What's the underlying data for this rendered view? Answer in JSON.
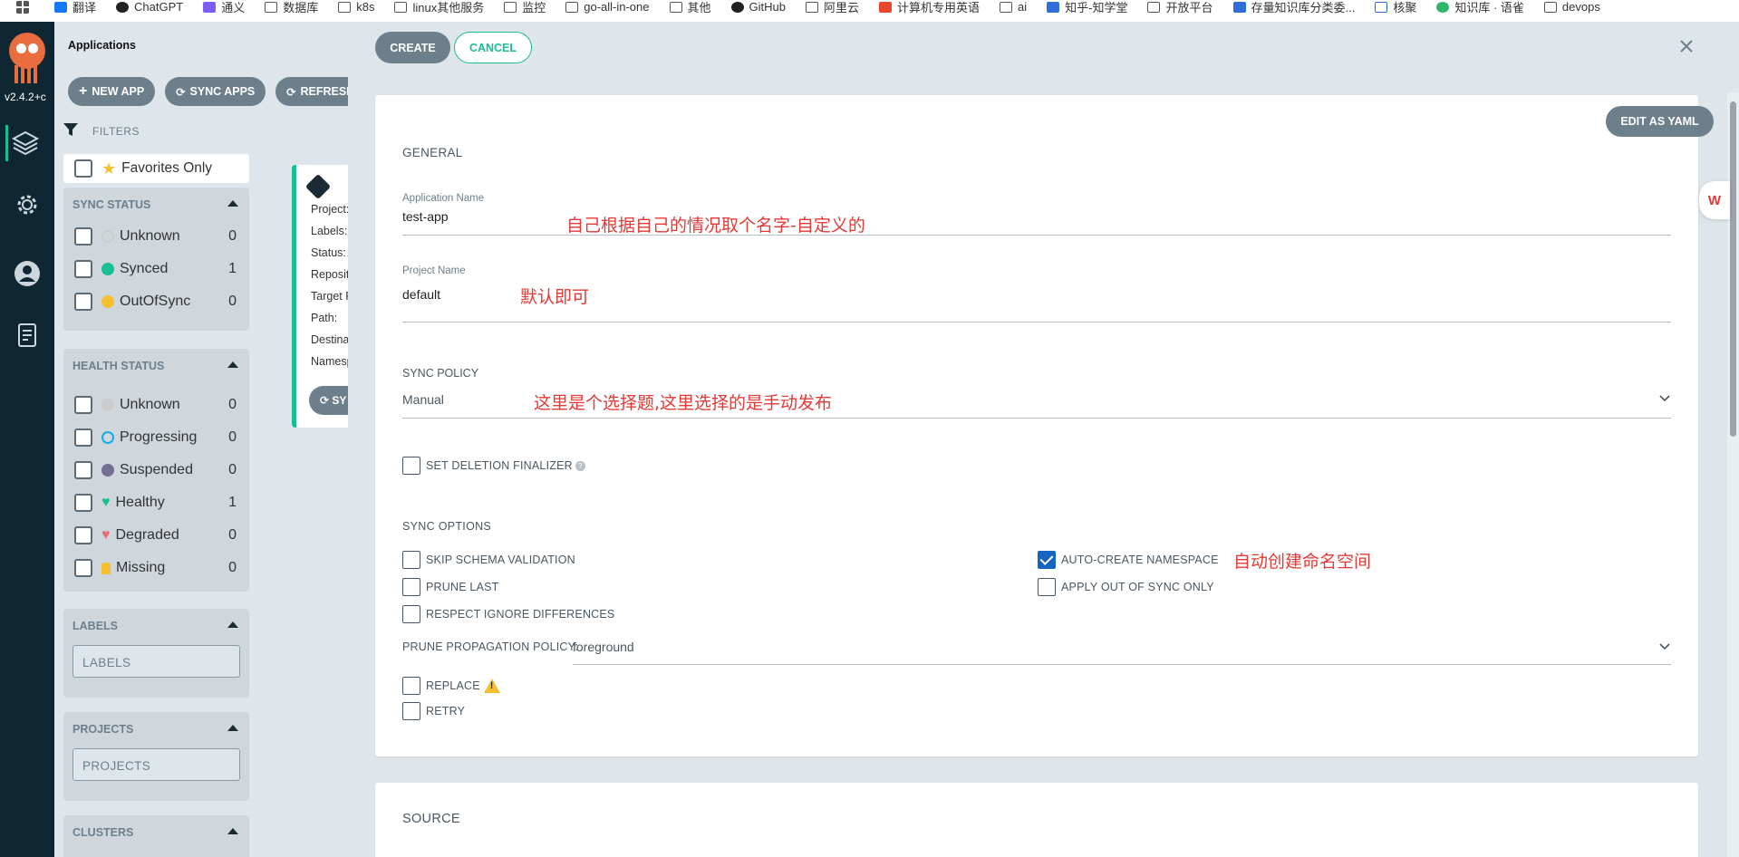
{
  "bookmarks": [
    {
      "label": "翻译",
      "icon": "translate-icon"
    },
    {
      "label": "ChatGPT",
      "icon": "chatgpt-icon"
    },
    {
      "label": "通义",
      "icon": "tongyi-icon"
    },
    {
      "label": "数据库",
      "icon": "folder-icon"
    },
    {
      "label": "k8s",
      "icon": "folder-icon"
    },
    {
      "label": "linux其他服务",
      "icon": "folder-icon"
    },
    {
      "label": "监控",
      "icon": "folder-icon"
    },
    {
      "label": "go-all-in-one",
      "icon": "folder-icon"
    },
    {
      "label": "其他",
      "icon": "folder-icon"
    },
    {
      "label": "GitHub",
      "icon": "github-icon"
    },
    {
      "label": "阿里云",
      "icon": "folder-icon"
    },
    {
      "label": "计算机专用英语",
      "icon": "csdn-icon"
    },
    {
      "label": "ai",
      "icon": "folder-icon"
    },
    {
      "label": "知乎-知学堂",
      "icon": "zhihu-icon"
    },
    {
      "label": "开放平台",
      "icon": "folder-icon"
    },
    {
      "label": "存量知识库分类委...",
      "icon": "zhihu-icon"
    },
    {
      "label": "核聚",
      "icon": "hejv-icon"
    },
    {
      "label": "知识库 · 语雀",
      "icon": "yuque-icon"
    },
    {
      "label": "devops",
      "icon": "folder-icon"
    }
  ],
  "nav": {
    "version": "v2.4.2+c",
    "items": [
      "applications-icon",
      "settings-icon",
      "user-icon",
      "docs-icon"
    ]
  },
  "apps": {
    "title": "Applications",
    "toolbar": {
      "new_app": "NEW APP",
      "sync_apps": "SYNC APPS",
      "refresh": "REFRESH"
    },
    "filters_label": "FILTERS",
    "favorites": "Favorites Only",
    "sync_status": {
      "title": "SYNC STATUS",
      "items": [
        {
          "label": "Unknown",
          "count": "0",
          "color": "#cccccc"
        },
        {
          "label": "Synced",
          "count": "1",
          "color": "#18be94"
        },
        {
          "label": "OutOfSync",
          "count": "0",
          "color": "#f4c030"
        }
      ]
    },
    "health_status": {
      "title": "HEALTH STATUS",
      "items": [
        {
          "label": "Unknown",
          "count": "0",
          "color": "#cccccc"
        },
        {
          "label": "Progressing",
          "count": "0",
          "color": "#0dadea"
        },
        {
          "label": "Suspended",
          "count": "0",
          "color": "#766f94"
        },
        {
          "label": "Healthy",
          "count": "1",
          "color": "#18be94"
        },
        {
          "label": "Degraded",
          "count": "0",
          "color": "#e96d76"
        },
        {
          "label": "Missing",
          "count": "0",
          "color": "#f4c030"
        }
      ]
    },
    "labels": {
      "title": "LABELS",
      "placeholder": "LABELS"
    },
    "projects": {
      "title": "PROJECTS",
      "placeholder": "PROJECTS"
    },
    "clusters": {
      "title": "CLUSTERS"
    },
    "card_fields": [
      "Project:",
      "Labels:",
      "Status:",
      "Reposit",
      "Target R",
      "Path:",
      "Destina",
      "Namesp"
    ],
    "card_button": "SY"
  },
  "panel": {
    "create": "CREATE",
    "cancel": "CANCEL",
    "edit_yaml": "EDIT AS YAML",
    "general": "GENERAL",
    "app_name_label": "Application Name",
    "app_name_value": "test-app",
    "app_name_note": "自己根据自己的情况取个名字-自定义的",
    "project_label": "Project Name",
    "project_value": "default",
    "project_note": "默认即可",
    "sync_policy_label": "SYNC POLICY",
    "sync_policy_value": "Manual",
    "sync_policy_note": "这里是个选择题,这里选择的是手动发布",
    "deletion_finalizer": "SET DELETION FINALIZER",
    "sync_options_label": "SYNC OPTIONS",
    "options_left": [
      {
        "label": "SKIP SCHEMA VALIDATION",
        "checked": false
      },
      {
        "label": "PRUNE LAST",
        "checked": false
      },
      {
        "label": "RESPECT IGNORE DIFFERENCES",
        "checked": false
      }
    ],
    "options_right": [
      {
        "label": "AUTO-CREATE NAMESPACE",
        "checked": true
      },
      {
        "label": "APPLY OUT OF SYNC ONLY",
        "checked": false
      }
    ],
    "auto_ns_note": "自动创建命名空间",
    "prune_policy_label": "PRUNE PROPAGATION POLICY:",
    "prune_policy_value": "foreground",
    "replace": "REPLACE",
    "retry": "RETRY",
    "source": "SOURCE"
  },
  "colors": {
    "accent": "#18be94",
    "nav_bg": "#0f2733",
    "note_red": "#e53935",
    "check_blue": "#1565c0"
  }
}
